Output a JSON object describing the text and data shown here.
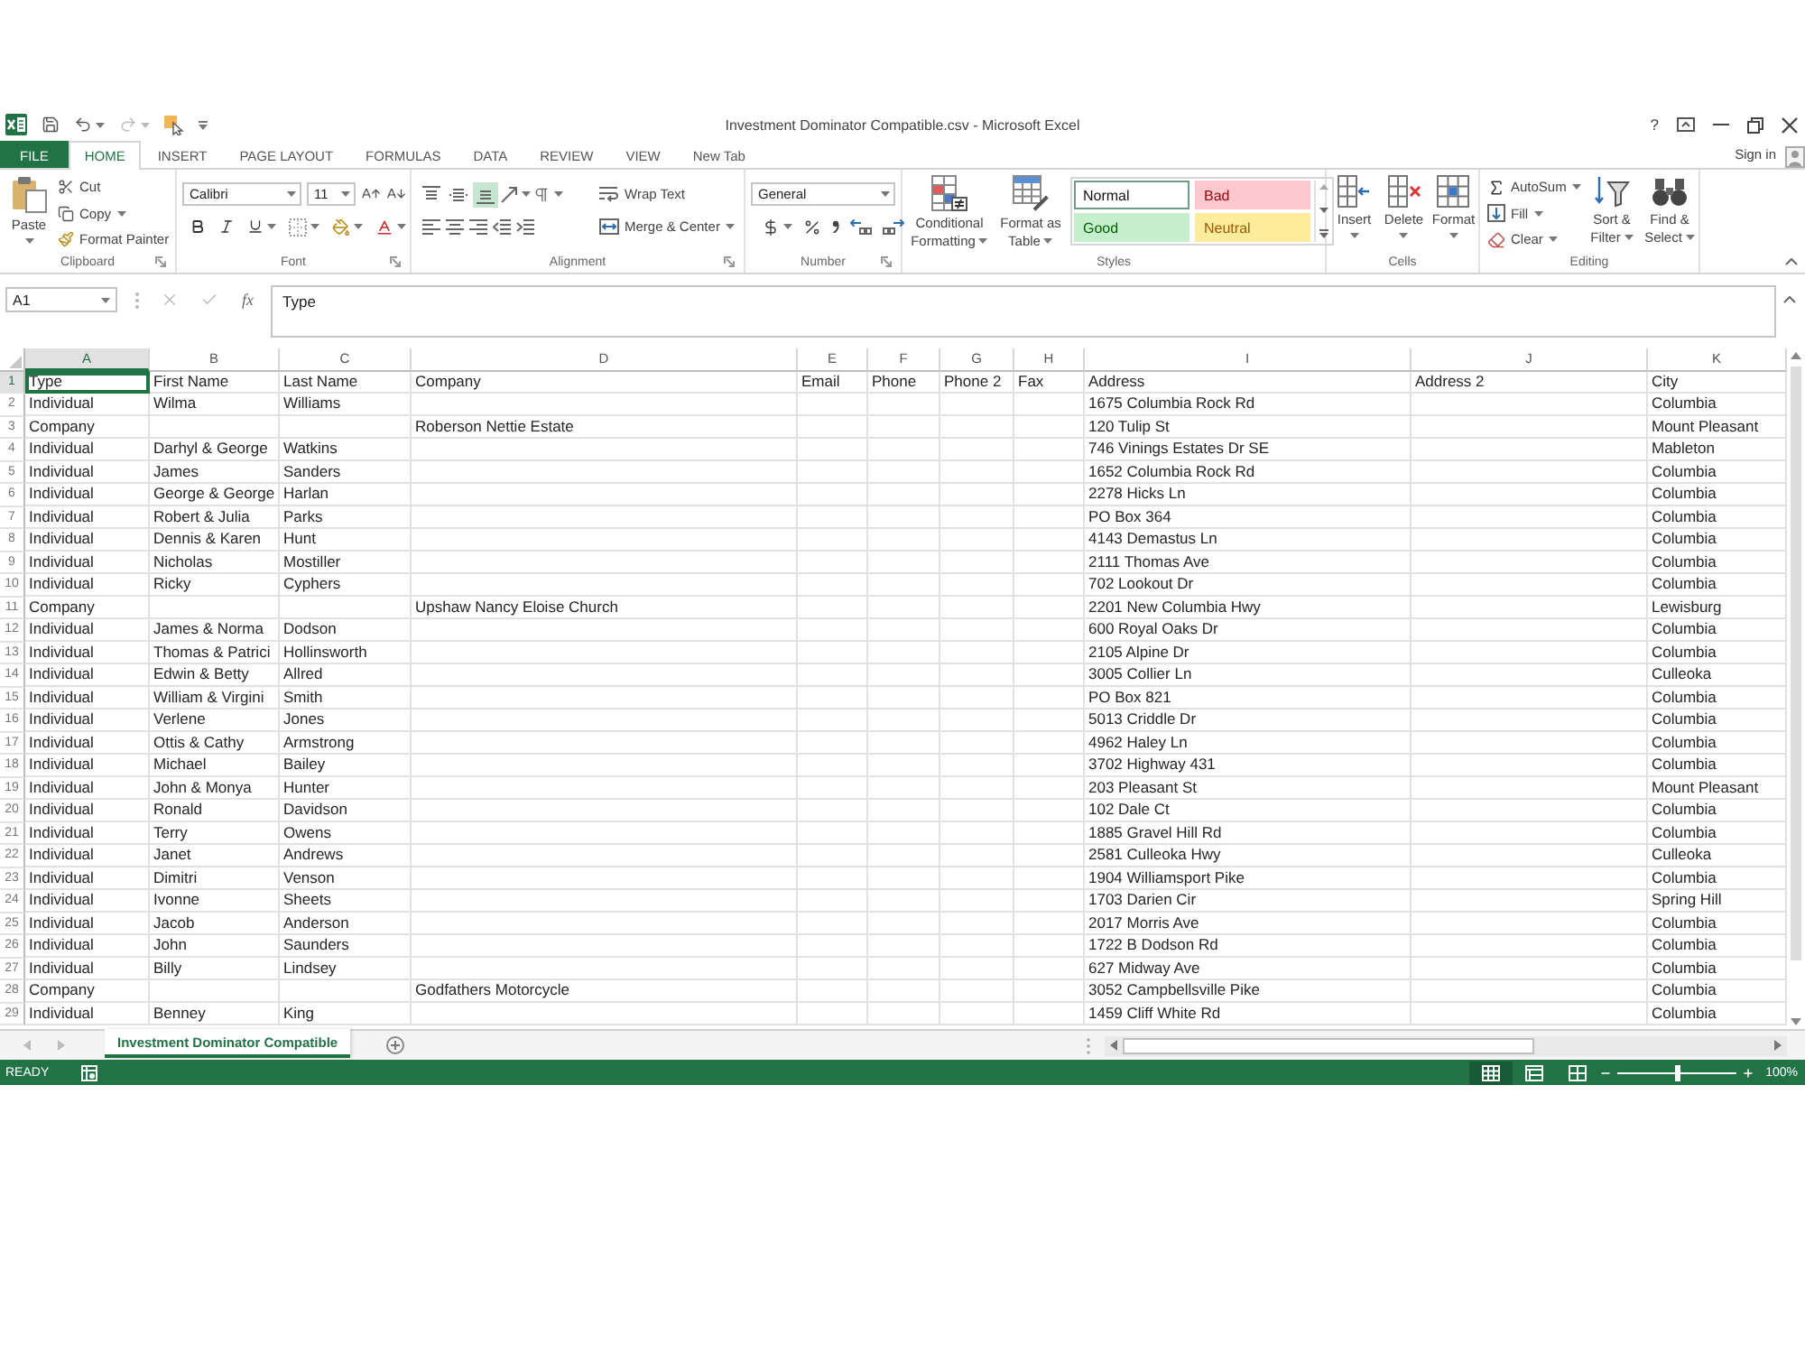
{
  "window": {
    "title": "Investment Dominator Compatible.csv - Microsoft Excel",
    "help": "?"
  },
  "ribbon_tabs": [
    {
      "label": "FILE",
      "kind": "file",
      "selected": false
    },
    {
      "label": "HOME",
      "kind": "tab",
      "selected": true
    },
    {
      "label": "INSERT",
      "kind": "tab",
      "selected": false
    },
    {
      "label": "PAGE LAYOUT",
      "kind": "tab",
      "selected": false
    },
    {
      "label": "FORMULAS",
      "kind": "tab",
      "selected": false
    },
    {
      "label": "DATA",
      "kind": "tab",
      "selected": false
    },
    {
      "label": "REVIEW",
      "kind": "tab",
      "selected": false
    },
    {
      "label": "VIEW",
      "kind": "tab",
      "selected": false
    },
    {
      "label": "New Tab",
      "kind": "tab",
      "selected": false
    }
  ],
  "account": {
    "label": "Sign in"
  },
  "ribbon": {
    "clipboard": {
      "label": "Clipboard",
      "paste": "Paste",
      "cut": "Cut",
      "copy": "Copy",
      "format_painter": "Format Painter"
    },
    "font": {
      "label": "Font",
      "font_name": "Calibri",
      "font_size": "11"
    },
    "alignment": {
      "label": "Alignment",
      "vertical_align": [
        {
          "kind": "top",
          "selected": false
        },
        {
          "kind": "middle",
          "selected": false
        },
        {
          "kind": "bottom",
          "selected": true
        }
      ],
      "wrap_text": "Wrap Text",
      "merge": "Merge & Center"
    },
    "number": {
      "label": "Number",
      "format": "General"
    },
    "styles": {
      "label": "Styles",
      "conditional_formatting": "Conditional Formatting",
      "format_as_table": "Format as Table",
      "cell_styles": [
        {
          "label": "Normal",
          "kind": "normal",
          "color": "#ffffff",
          "selected": true
        },
        {
          "label": "Bad",
          "kind": "bad",
          "color": "#ffc7ce",
          "selected": false
        },
        {
          "label": "Good",
          "kind": "good",
          "color": "#c6efce",
          "selected": false
        },
        {
          "label": "Neutral",
          "kind": "neutral",
          "color": "#ffeb9c",
          "selected": false
        }
      ]
    },
    "cells": {
      "label": "Cells",
      "buttons": [
        {
          "label": "Insert",
          "kind": "insert"
        },
        {
          "label": "Delete",
          "kind": "delete"
        },
        {
          "label": "Format",
          "kind": "format"
        }
      ]
    },
    "editing": {
      "label": "Editing",
      "autosum": "AutoSum",
      "fill": "Fill",
      "clear": "Clear",
      "sort_filter": "Sort & Filter",
      "find_select": "Find & Select"
    }
  },
  "formula_bar": {
    "name_box": "A1",
    "function_button": "fx",
    "value": "Type"
  },
  "sheet": {
    "columns": [
      {
        "letter": "A",
        "selected": true
      },
      {
        "letter": "B",
        "selected": false
      },
      {
        "letter": "C",
        "selected": false
      },
      {
        "letter": "D",
        "selected": false
      },
      {
        "letter": "E",
        "selected": false
      },
      {
        "letter": "F",
        "selected": false
      },
      {
        "letter": "G",
        "selected": false
      },
      {
        "letter": "H",
        "selected": false
      },
      {
        "letter": "I",
        "selected": false
      },
      {
        "letter": "J",
        "selected": false
      },
      {
        "letter": "K",
        "selected": false
      }
    ],
    "rows": [
      {
        "number": "1",
        "selected": true,
        "cells": [
          "Type",
          "First Name",
          "Last Name",
          "Company",
          "Email",
          "Phone",
          "Phone 2",
          "Fax",
          "Address",
          "Address 2",
          "City"
        ]
      },
      {
        "number": "2",
        "selected": false,
        "cells": [
          "Individual",
          "Wilma",
          "Williams",
          null,
          null,
          null,
          null,
          null,
          "1675 Columbia Rock Rd",
          null,
          "Columbia"
        ]
      },
      {
        "number": "3",
        "selected": false,
        "cells": [
          "Company",
          null,
          null,
          "Roberson Nettie Estate",
          null,
          null,
          null,
          null,
          "120 Tulip St",
          null,
          "Mount Pleasant"
        ]
      },
      {
        "number": "4",
        "selected": false,
        "cells": [
          "Individual",
          "Darhyl & George",
          "Watkins",
          null,
          null,
          null,
          null,
          null,
          "746 Vinings Estates Dr SE",
          null,
          "Mableton"
        ]
      },
      {
        "number": "5",
        "selected": false,
        "cells": [
          "Individual",
          "James",
          "Sanders",
          null,
          null,
          null,
          null,
          null,
          "1652 Columbia Rock Rd",
          null,
          "Columbia"
        ]
      },
      {
        "number": "6",
        "selected": false,
        "cells": [
          "Individual",
          "George & George",
          "Harlan",
          null,
          null,
          null,
          null,
          null,
          "2278 Hicks Ln",
          null,
          "Columbia"
        ]
      },
      {
        "number": "7",
        "selected": false,
        "cells": [
          "Individual",
          "Robert & Julia",
          "Parks",
          null,
          null,
          null,
          null,
          null,
          "PO Box 364",
          null,
          "Columbia"
        ]
      },
      {
        "number": "8",
        "selected": false,
        "cells": [
          "Individual",
          "Dennis & Karen",
          "Hunt",
          null,
          null,
          null,
          null,
          null,
          "4143 Demastus Ln",
          null,
          "Columbia"
        ]
      },
      {
        "number": "9",
        "selected": false,
        "cells": [
          "Individual",
          "Nicholas",
          "Mostiller",
          null,
          null,
          null,
          null,
          null,
          "2111 Thomas Ave",
          null,
          "Columbia"
        ]
      },
      {
        "number": "10",
        "selected": false,
        "cells": [
          "Individual",
          "Ricky",
          "Cyphers",
          null,
          null,
          null,
          null,
          null,
          "702 Lookout Dr",
          null,
          "Columbia"
        ]
      },
      {
        "number": "11",
        "selected": false,
        "cells": [
          "Company",
          null,
          null,
          "Upshaw Nancy Eloise Church",
          null,
          null,
          null,
          null,
          "2201 New Columbia Hwy",
          null,
          "Lewisburg"
        ]
      },
      {
        "number": "12",
        "selected": false,
        "cells": [
          "Individual",
          "James & Norma",
          "Dodson",
          null,
          null,
          null,
          null,
          null,
          "600 Royal Oaks Dr",
          null,
          "Columbia"
        ]
      },
      {
        "number": "13",
        "selected": false,
        "cells": [
          "Individual",
          "Thomas & Patrici",
          "Hollinsworth",
          null,
          null,
          null,
          null,
          null,
          "2105 Alpine Dr",
          null,
          "Columbia"
        ]
      },
      {
        "number": "14",
        "selected": false,
        "cells": [
          "Individual",
          "Edwin & Betty",
          "Allred",
          null,
          null,
          null,
          null,
          null,
          "3005 Collier Ln",
          null,
          "Culleoka"
        ]
      },
      {
        "number": "15",
        "selected": false,
        "cells": [
          "Individual",
          "William & Virgini",
          "Smith",
          null,
          null,
          null,
          null,
          null,
          "PO Box 821",
          null,
          "Columbia"
        ]
      },
      {
        "number": "16",
        "selected": false,
        "cells": [
          "Individual",
          "Verlene",
          "Jones",
          null,
          null,
          null,
          null,
          null,
          "5013 Criddle Dr",
          null,
          "Columbia"
        ]
      },
      {
        "number": "17",
        "selected": false,
        "cells": [
          "Individual",
          "Ottis & Cathy",
          "Armstrong",
          null,
          null,
          null,
          null,
          null,
          "4962 Haley Ln",
          null,
          "Columbia"
        ]
      },
      {
        "number": "18",
        "selected": false,
        "cells": [
          "Individual",
          "Michael",
          "Bailey",
          null,
          null,
          null,
          null,
          null,
          "3702 Highway 431",
          null,
          "Columbia"
        ]
      },
      {
        "number": "19",
        "selected": false,
        "cells": [
          "Individual",
          "John & Monya",
          "Hunter",
          null,
          null,
          null,
          null,
          null,
          "203 Pleasant St",
          null,
          "Mount Pleasant"
        ]
      },
      {
        "number": "20",
        "selected": false,
        "cells": [
          "Individual",
          "Ronald",
          "Davidson",
          null,
          null,
          null,
          null,
          null,
          "102 Dale Ct",
          null,
          "Columbia"
        ]
      },
      {
        "number": "21",
        "selected": false,
        "cells": [
          "Individual",
          "Terry",
          "Owens",
          null,
          null,
          null,
          null,
          null,
          "1885 Gravel Hill Rd",
          null,
          "Columbia"
        ]
      },
      {
        "number": "22",
        "selected": false,
        "cells": [
          "Individual",
          "Janet",
          "Andrews",
          null,
          null,
          null,
          null,
          null,
          "2581 Culleoka Hwy",
          null,
          "Culleoka"
        ]
      },
      {
        "number": "23",
        "selected": false,
        "cells": [
          "Individual",
          "Dimitri",
          "Venson",
          null,
          null,
          null,
          null,
          null,
          "1904 Williamsport Pike",
          null,
          "Columbia"
        ]
      },
      {
        "number": "24",
        "selected": false,
        "cells": [
          "Individual",
          "Ivonne",
          "Sheets",
          null,
          null,
          null,
          null,
          null,
          "1703 Darien Cir",
          null,
          "Spring Hill"
        ]
      },
      {
        "number": "25",
        "selected": false,
        "cells": [
          "Individual",
          "Jacob",
          "Anderson",
          null,
          null,
          null,
          null,
          null,
          "2017 Morris Ave",
          null,
          "Columbia"
        ]
      },
      {
        "number": "26",
        "selected": false,
        "cells": [
          "Individual",
          "John",
          "Saunders",
          null,
          null,
          null,
          null,
          null,
          "1722 B Dodson Rd",
          null,
          "Columbia"
        ]
      },
      {
        "number": "27",
        "selected": false,
        "cells": [
          "Individual",
          "Billy",
          "Lindsey",
          null,
          null,
          null,
          null,
          null,
          "627 Midway Ave",
          null,
          "Columbia"
        ]
      },
      {
        "number": "28",
        "selected": false,
        "cells": [
          "Company",
          null,
          null,
          "Godfathers Motorcycle",
          null,
          null,
          null,
          null,
          "3052 Campbellsville Pike",
          null,
          "Columbia"
        ]
      },
      {
        "number": "29",
        "selected": false,
        "cells": [
          "Individual",
          "Benney",
          "King",
          null,
          null,
          null,
          null,
          null,
          "1459 Cliff White Rd",
          null,
          "Columbia"
        ]
      }
    ]
  },
  "sheet_tabs": [
    {
      "label": "Investment Dominator Compatible",
      "selected": true
    }
  ],
  "status_bar": {
    "status": "READY",
    "views": [
      {
        "kind": "normal",
        "selected": true
      },
      {
        "kind": "page_layout",
        "selected": false
      },
      {
        "kind": "page_break",
        "selected": false
      }
    ],
    "zoom_slider": {
      "level": 0.5
    },
    "zoom": "100%"
  }
}
